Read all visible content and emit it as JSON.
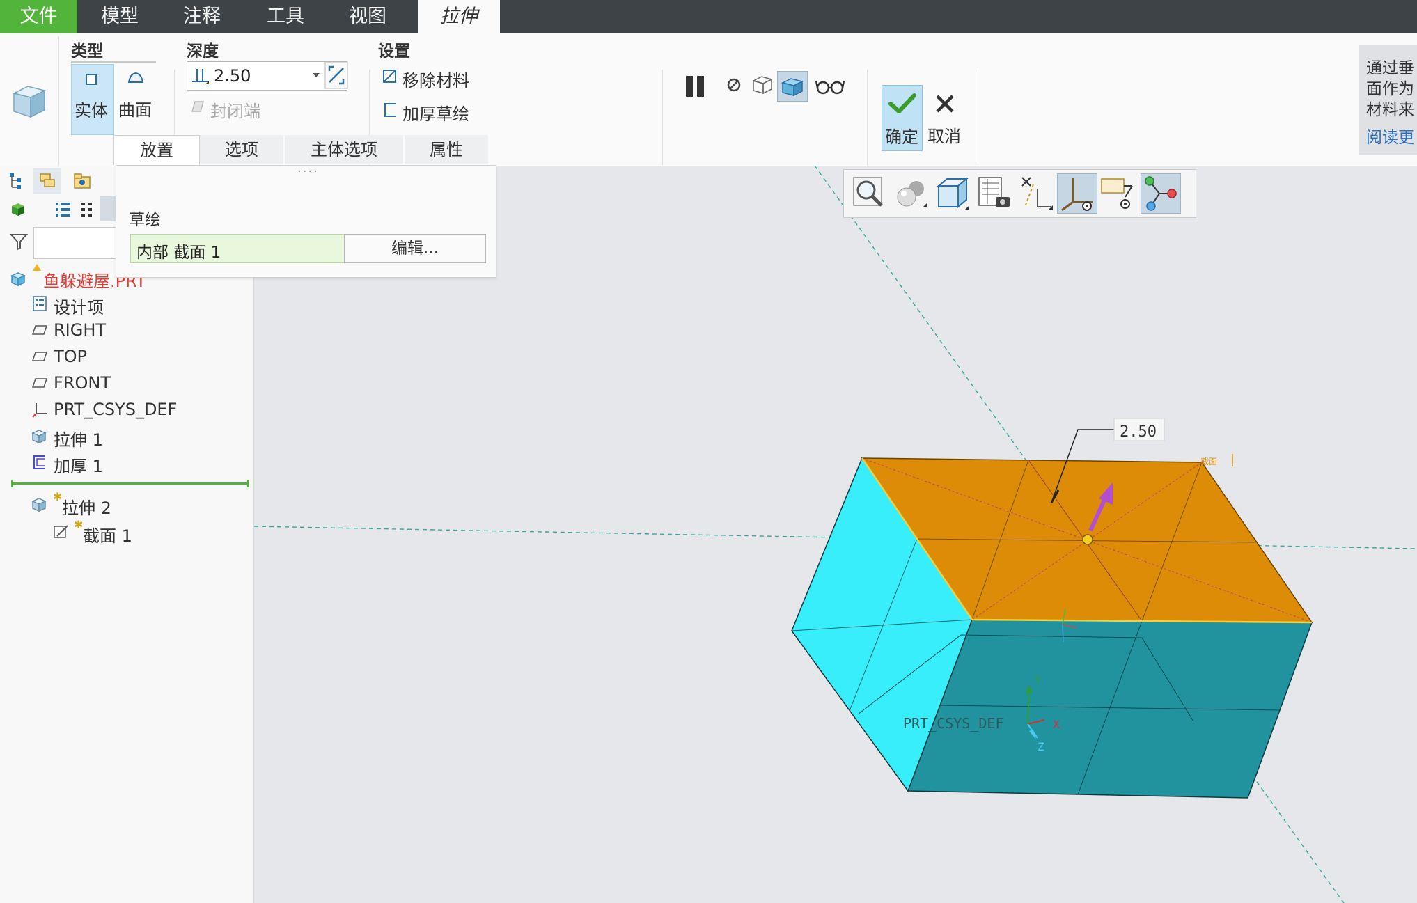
{
  "menu": {
    "file": "文件",
    "model": "模型",
    "annotate": "注释",
    "tools": "工具",
    "view": "视图",
    "extrude": "拉伸"
  },
  "ribbon": {
    "type": {
      "title": "类型",
      "solid": "实体",
      "surface": "曲面"
    },
    "depth": {
      "title": "深度",
      "value": "2.50",
      "cap_ends": "封闭端"
    },
    "settings": {
      "title": "设置",
      "remove_material": "移除材料",
      "thicken_sketch": "加厚草绘"
    },
    "ok": "确定",
    "cancel": "取消",
    "tabs": [
      "放置",
      "选项",
      "主体选项",
      "属性"
    ]
  },
  "tip": {
    "line1": "通过垂",
    "line2": "面作为",
    "line3": "材料来",
    "link": "阅读更"
  },
  "placement": {
    "label": "草绘",
    "section": "内部 截面 1",
    "edit": "编辑..."
  },
  "tree": {
    "root": "鱼躲避屋.PRT",
    "items": [
      "设计项",
      "RIGHT",
      "TOP",
      "FRONT",
      "PRT_CSYS_DEF",
      "拉伸 1",
      "加厚 1"
    ],
    "inserted": [
      "拉伸 2",
      "截面 1"
    ]
  },
  "viewport": {
    "dimension": "2.50",
    "section_tag": "截面",
    "csys_label": "PRT_CSYS_DEF",
    "axis_x": "X",
    "axis_y": "Y",
    "axis_z": "Z"
  },
  "colors": {
    "accent_green": "#52b43a",
    "top_face": "#dc8c06",
    "left_face": "#38eefa",
    "front_face": "#21939e",
    "arrow": "#b24fd1"
  }
}
